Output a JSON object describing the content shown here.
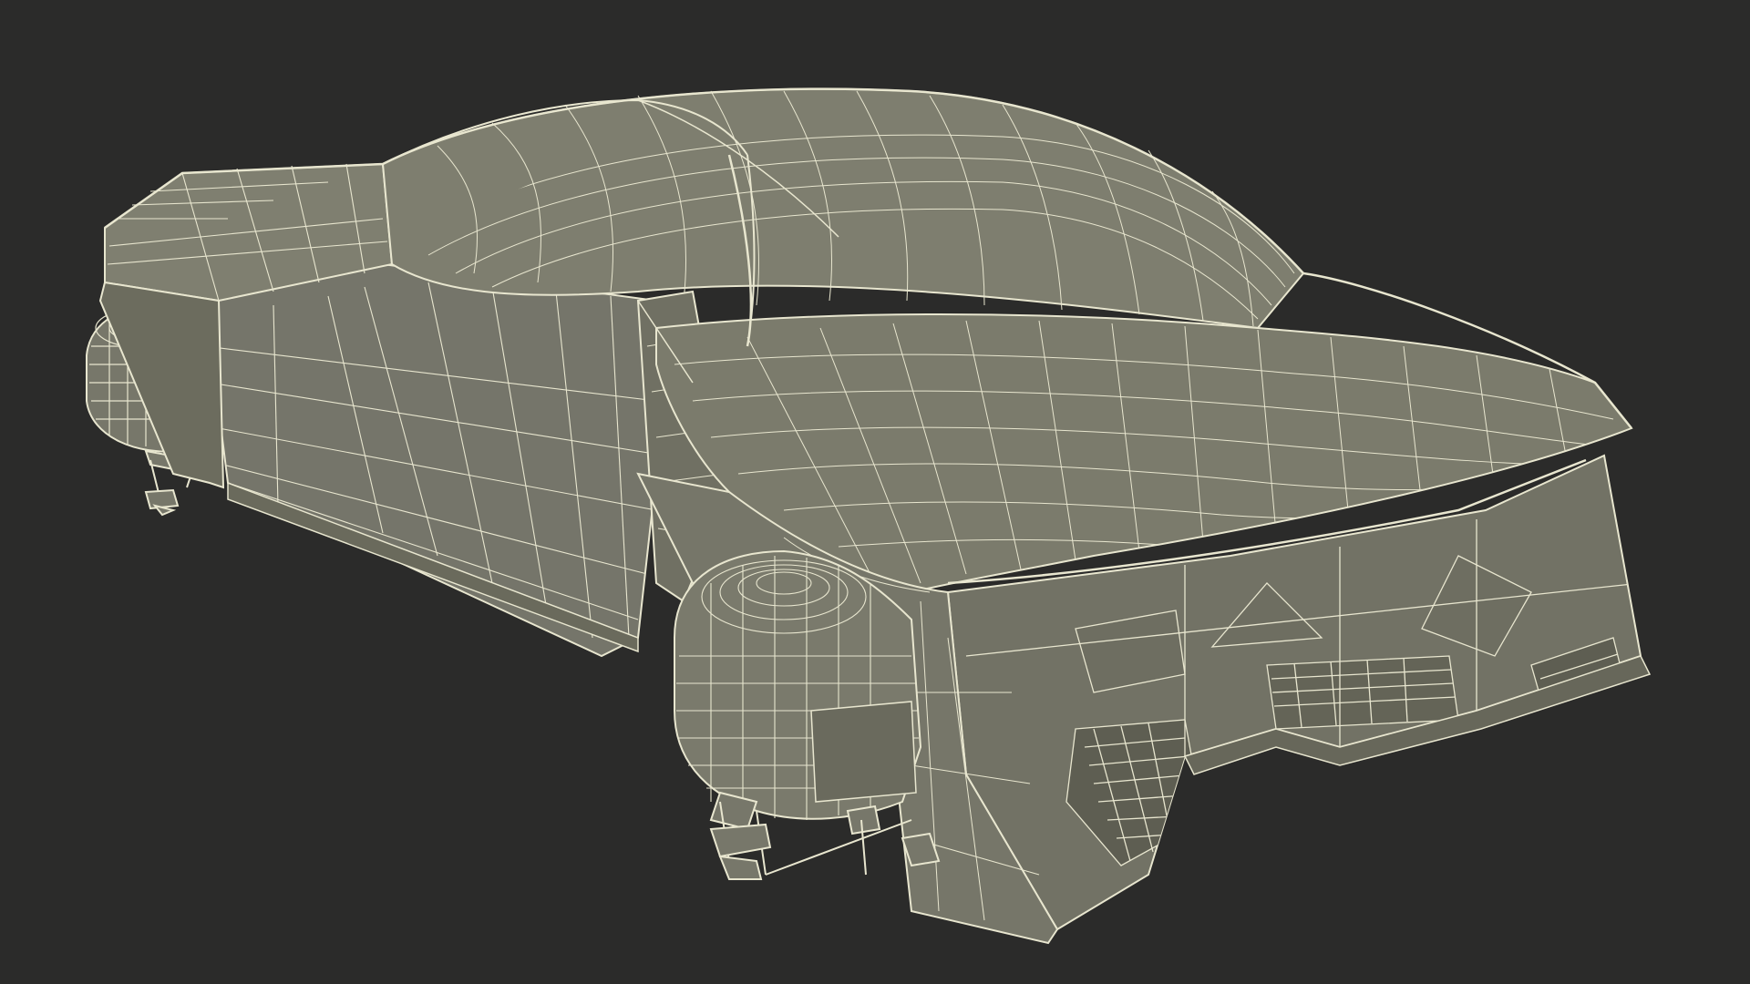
{
  "scene": {
    "subject": "wireframe-concept-car",
    "view": "rear-three-quarter-perspective",
    "style": "shaded-wireframe"
  },
  "colors": {
    "background": "#2b2b2a",
    "surface_fill": "#7d7d6e",
    "surface_fill_light": "#8a8a7a",
    "surface_fill_dark": "#6a6a5c",
    "shadow_fill": "#555548",
    "wire": "#e8e6cf",
    "wire_dim": "#cfcdb6"
  },
  "icons": {
    "body": "car-body-icon",
    "wheel": "wheel-icon",
    "suspension": "suspension-arm-icon"
  }
}
